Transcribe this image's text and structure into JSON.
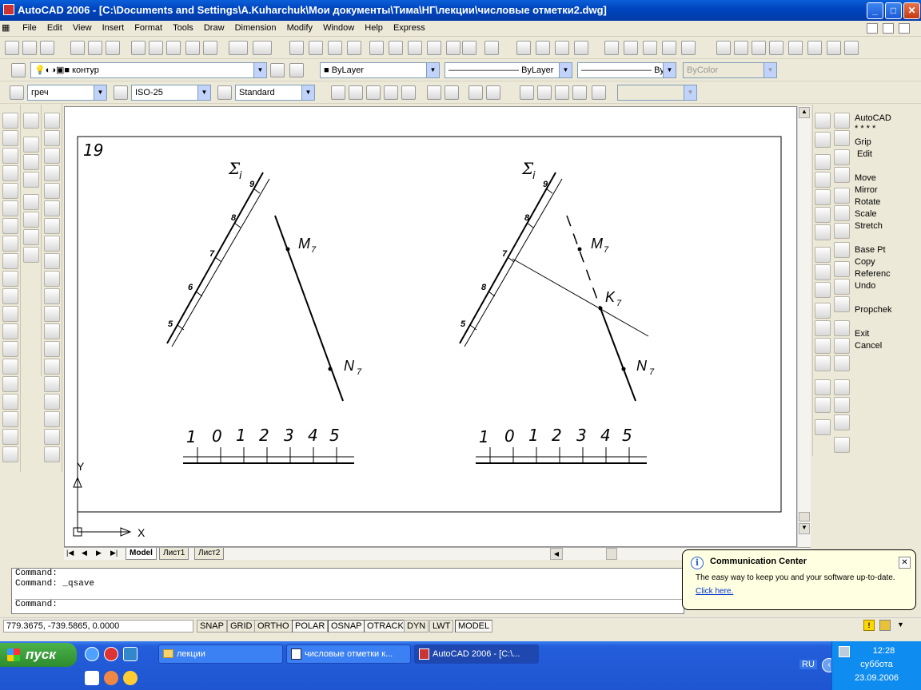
{
  "window": {
    "title": "AutoCAD 2006 - [C:\\Documents and Settings\\A.Kuharchuk\\Мои документы\\Тима\\НГ\\лекции\\числовые отметки2.dwg]",
    "minimize": "_",
    "maximize": "□",
    "close": "✕"
  },
  "menu": [
    "File",
    "Edit",
    "View",
    "Insert",
    "Format",
    "Tools",
    "Draw",
    "Dimension",
    "Modify",
    "Window",
    "Help",
    "Express"
  ],
  "layers": {
    "current_layer": "контур",
    "color": "ByLayer",
    "linetype": "ByLayer",
    "lineweight": "ByLayer",
    "plotstyle": "ByColor"
  },
  "styles": {
    "text_style": "греч",
    "dim_style": "ISO-25",
    "table_style": "Standard"
  },
  "drawing": {
    "sheet_number": "19",
    "left": {
      "sigma": "Σ",
      "sigma_sub": "i",
      "scale_labels": [
        "9",
        "8",
        "7",
        "6",
        "5"
      ],
      "point_m": "M",
      "point_n": "N",
      "subscript": "7"
    },
    "right": {
      "sigma": "Σ",
      "sigma_sub": "i",
      "scale_labels": [
        "9",
        "8",
        "7",
        "8",
        "5"
      ],
      "point_m": "M",
      "point_k": "K",
      "point_n": "N",
      "subscript": "7"
    },
    "linear_scale": [
      "1",
      "0",
      "1",
      "2",
      "3",
      "4",
      "5"
    ],
    "ucs_x": "X",
    "ucs_y": "Y"
  },
  "layout_tabs": [
    "Model",
    "Лист1",
    "Лист2"
  ],
  "command_lines": [
    "Command:",
    "Command: _qsave",
    "Command:"
  ],
  "status": {
    "coords": "779.3675, -739.5865, 0.0000",
    "buttons": [
      {
        "label": "SNAP",
        "on": false
      },
      {
        "label": "GRID",
        "on": false
      },
      {
        "label": "ORTHO",
        "on": false
      },
      {
        "label": "POLAR",
        "on": true
      },
      {
        "label": "OSNAP",
        "on": true
      },
      {
        "label": "OTRACK",
        "on": true
      },
      {
        "label": "DYN",
        "on": false
      },
      {
        "label": "LWT",
        "on": false
      },
      {
        "label": "MODEL",
        "on": true
      }
    ]
  },
  "grip_panel": {
    "items": [
      "AutoCAD",
      "* * * *",
      "Grip",
      "Edit",
      "Move",
      "Mirror",
      "Rotate",
      "Scale",
      "Stretch",
      "Base Pt",
      "Copy",
      "Referenc",
      "Undo",
      "Propchek",
      "Exit",
      "Cancel"
    ]
  },
  "balloon": {
    "title": "Communication Center",
    "text": "The easy way to keep you and your software up-to-date.",
    "link": "Click here."
  },
  "taskbar": {
    "start": "пуск",
    "items": [
      "лекции",
      "числовые отметки к...",
      "AutoCAD 2006 - [C:\\..."
    ],
    "lang": "RU",
    "time": "12:28",
    "day": "суббота",
    "date": "23.09.2006"
  },
  "colors": {
    "titlebar": "#0046c0",
    "taskbar": "#245edb",
    "start": "#2e8b2e",
    "balloon": "#ffffe1"
  }
}
